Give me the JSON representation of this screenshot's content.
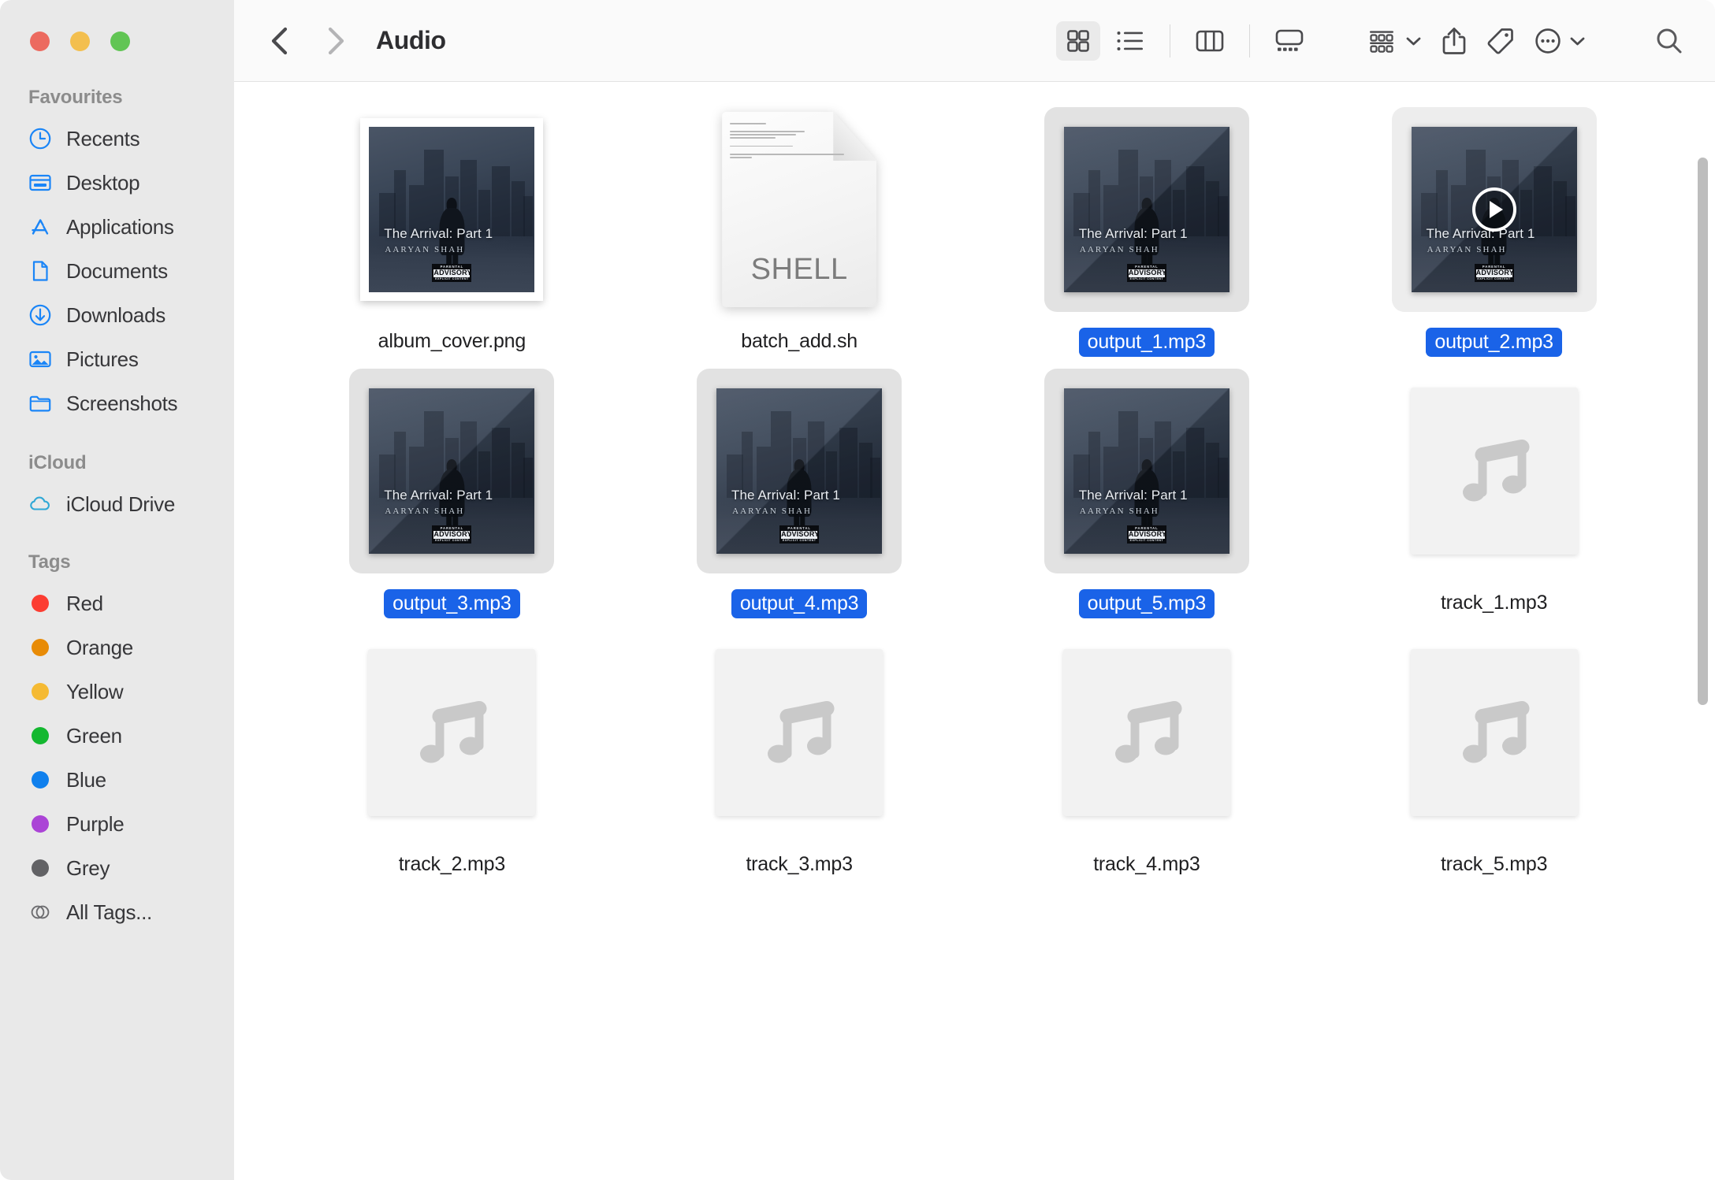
{
  "window": {
    "traffic_lights": [
      {
        "name": "close",
        "color": "#ec6a5f"
      },
      {
        "name": "minimize",
        "color": "#f3bf4f"
      },
      {
        "name": "maximize",
        "color": "#61c554"
      }
    ]
  },
  "toolbar": {
    "back_label": "Back",
    "forward_label": "Forward",
    "title": "Audio",
    "views": [
      {
        "name": "icon-view",
        "label": "Icon View",
        "active": true
      },
      {
        "name": "list-view",
        "label": "List View",
        "active": false
      },
      {
        "name": "column-view",
        "label": "Column View",
        "active": false
      },
      {
        "name": "gallery-view",
        "label": "Gallery View",
        "active": false
      }
    ],
    "group_label": "Group",
    "share_label": "Share",
    "tag_label": "Tags",
    "more_label": "More",
    "search_label": "Search"
  },
  "sidebar": {
    "sections": [
      {
        "title": "Favourites",
        "items": [
          {
            "label": "Recents",
            "icon": "clock-icon"
          },
          {
            "label": "Desktop",
            "icon": "desktop-icon"
          },
          {
            "label": "Applications",
            "icon": "applications-icon"
          },
          {
            "label": "Documents",
            "icon": "document-icon"
          },
          {
            "label": "Downloads",
            "icon": "download-icon"
          },
          {
            "label": "Pictures",
            "icon": "pictures-icon"
          },
          {
            "label": "Screenshots",
            "icon": "folder-icon"
          }
        ]
      },
      {
        "title": "iCloud",
        "items": [
          {
            "label": "iCloud Drive",
            "icon": "cloud-icon"
          }
        ]
      },
      {
        "title": "Tags",
        "items": [
          {
            "label": "Red",
            "icon": "tag-dot",
            "color": "#fc3d32"
          },
          {
            "label": "Orange",
            "icon": "tag-dot",
            "color": "#e88b06"
          },
          {
            "label": "Yellow",
            "icon": "tag-dot",
            "color": "#f5ba33"
          },
          {
            "label": "Green",
            "icon": "tag-dot",
            "color": "#14b830"
          },
          {
            "label": "Blue",
            "icon": "tag-dot",
            "color": "#1080ed"
          },
          {
            "label": "Purple",
            "icon": "tag-dot",
            "color": "#ab44d6"
          },
          {
            "label": "Grey",
            "icon": "tag-dot",
            "color": "#626265"
          },
          {
            "label": "All Tags...",
            "icon": "all-tags-icon",
            "color": ""
          }
        ]
      }
    ]
  },
  "album_art": {
    "title": "The Arrival: Part 1",
    "artist": "AARYAN SHAH",
    "advisory_top": "PARENTAL",
    "advisory_mid": "ADVISORY",
    "advisory_bottom": "EXPLICIT CONTENT"
  },
  "doc_icon": {
    "type_label": "SHELL"
  },
  "files": [
    {
      "name": "album_cover.png",
      "kind": "image",
      "selected": false,
      "hover": false
    },
    {
      "name": "batch_add.sh",
      "kind": "shell",
      "selected": false,
      "hover": false
    },
    {
      "name": "output_1.mp3",
      "kind": "album",
      "selected": true,
      "hover": false
    },
    {
      "name": "output_2.mp3",
      "kind": "album",
      "selected": true,
      "hover": true
    },
    {
      "name": "output_3.mp3",
      "kind": "album",
      "selected": true,
      "hover": false
    },
    {
      "name": "output_4.mp3",
      "kind": "album",
      "selected": true,
      "hover": false
    },
    {
      "name": "output_5.mp3",
      "kind": "album",
      "selected": true,
      "hover": false
    },
    {
      "name": "track_1.mp3",
      "kind": "music",
      "selected": false,
      "hover": false
    },
    {
      "name": "track_2.mp3",
      "kind": "music",
      "selected": false,
      "hover": false
    },
    {
      "name": "track_3.mp3",
      "kind": "music",
      "selected": false,
      "hover": false
    },
    {
      "name": "track_4.mp3",
      "kind": "music",
      "selected": false,
      "hover": false
    },
    {
      "name": "track_5.mp3",
      "kind": "music",
      "selected": false,
      "hover": false
    }
  ],
  "colors": {
    "selection_blue": "#1a63e8",
    "sidebar_bg": "#e9e9e9",
    "accent_icon_blue": "#1a85f7"
  }
}
